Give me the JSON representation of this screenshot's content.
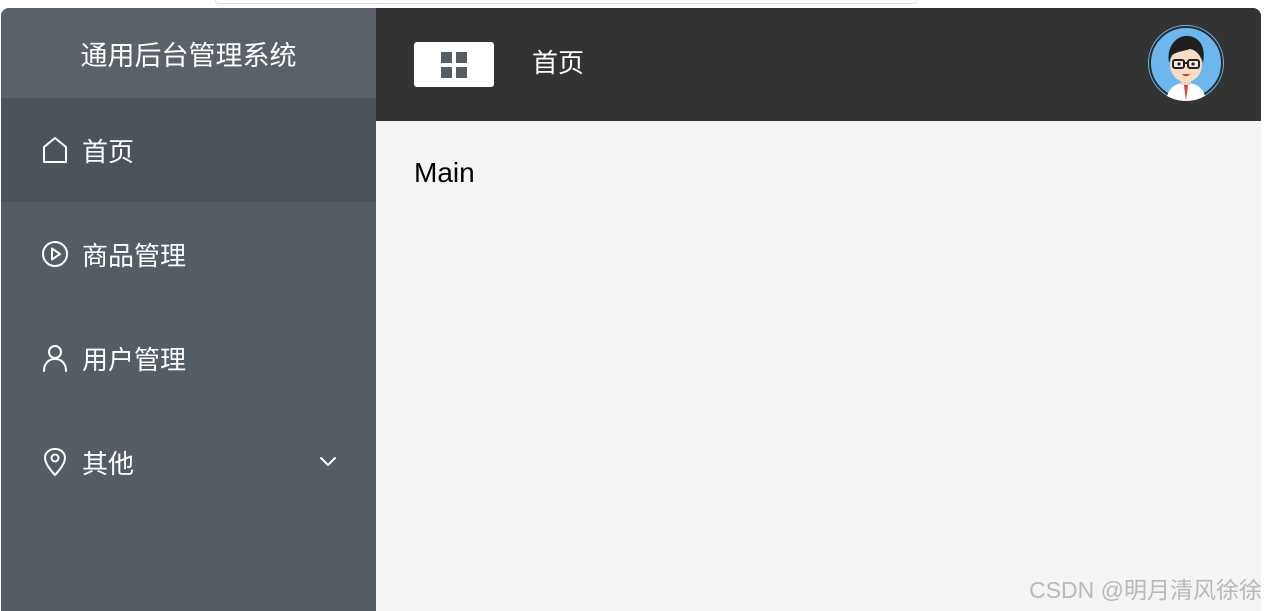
{
  "sidebar": {
    "title": "通用后台管理系统",
    "items": [
      {
        "label": "首页",
        "icon": "home-icon"
      },
      {
        "label": "商品管理",
        "icon": "video-play-icon"
      },
      {
        "label": "用户管理",
        "icon": "user-icon"
      },
      {
        "label": "其他",
        "icon": "location-icon"
      }
    ],
    "colors": {
      "background": "#545c64",
      "active": "#4b535b",
      "text": "#ffffff"
    }
  },
  "header": {
    "title": "首页",
    "collapse_icon": "menu-grid-icon",
    "avatar": "user-avatar",
    "background": "#333333"
  },
  "main": {
    "text": "Main"
  },
  "watermark": {
    "text": "CSDN @明月清风徐徐"
  }
}
